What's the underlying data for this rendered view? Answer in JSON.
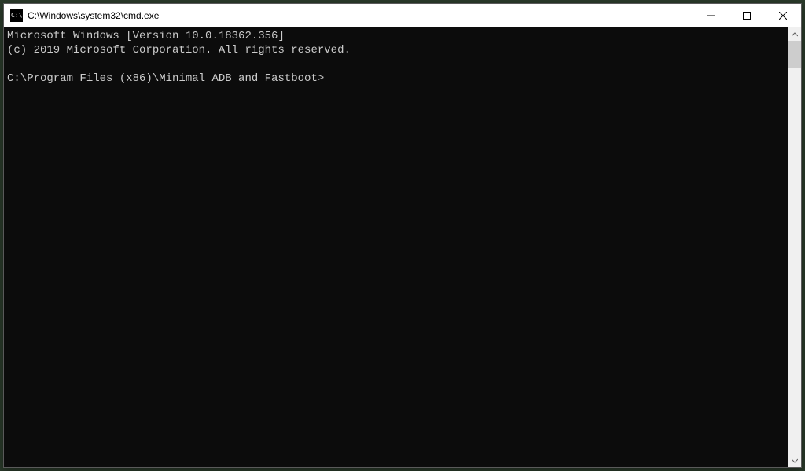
{
  "window": {
    "title": "C:\\Windows\\system32\\cmd.exe",
    "icon_text": "C:\\"
  },
  "terminal": {
    "line1": "Microsoft Windows [Version 10.0.18362.356]",
    "line2": "(c) 2019 Microsoft Corporation. All rights reserved.",
    "prompt": "C:\\Program Files (x86)\\Minimal ADB and Fastboot>"
  }
}
